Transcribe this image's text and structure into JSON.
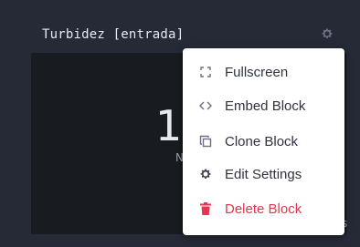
{
  "block": {
    "title": "Turbidez [entrada]",
    "settings_icon": "gear-icon",
    "value": "1",
    "unit": "N",
    "footer_mark": "s"
  },
  "context_menu": {
    "items": [
      {
        "label": "Fullscreen",
        "icon": "fullscreen-icon"
      },
      {
        "label": "Embed Block",
        "icon": "code-icon"
      },
      {
        "label": "Clone Block",
        "icon": "clone-icon"
      },
      {
        "label": "Edit Settings",
        "icon": "gear-icon"
      },
      {
        "label": "Delete Block",
        "icon": "trash-icon",
        "color": "#e63550"
      }
    ]
  },
  "colors": {
    "page_background": "#262a37",
    "block_background": "#181b1f",
    "menu_background": "#ffffff",
    "danger": "#e63550"
  }
}
